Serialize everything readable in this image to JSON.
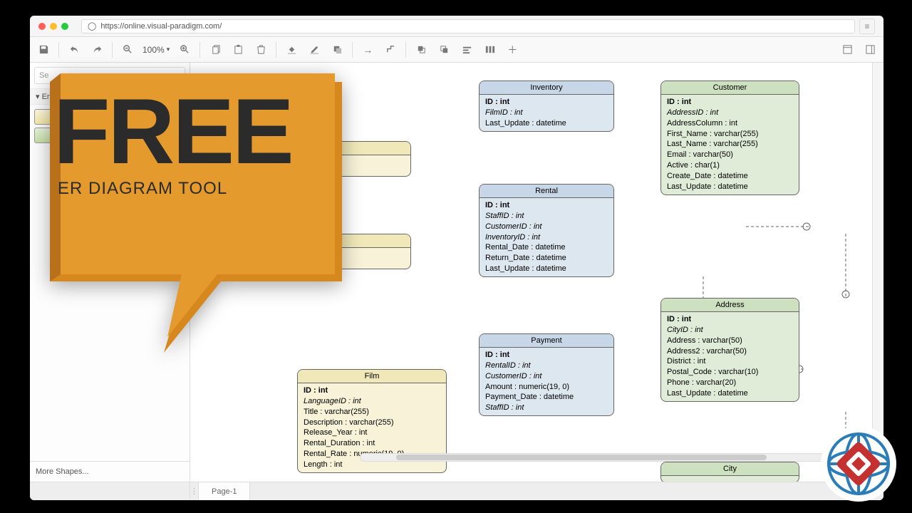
{
  "url": "https://online.visual-paradigm.com/",
  "toolbar": {
    "zoom": "100%"
  },
  "sidebar": {
    "search_placeholder": "Se",
    "panel": "En",
    "more": "More Shapes..."
  },
  "tabs": {
    "page1": "Page-1"
  },
  "promo": {
    "big": "FREE",
    "sub": "ER DIAGRAM TOOL"
  },
  "entities": {
    "film": {
      "title": "Film",
      "rows": [
        {
          "t": "ID : int",
          "c": "pk"
        },
        {
          "t": "LanguageID : int",
          "c": "fk"
        },
        {
          "t": "Title : varchar(255)"
        },
        {
          "t": "Description : varchar(255)"
        },
        {
          "t": "Release_Year : int"
        },
        {
          "t": "Rental_Duration : int"
        },
        {
          "t": "Rental_Rate : numeric(19, 0)"
        },
        {
          "t": "Length : int"
        }
      ]
    },
    "inventory": {
      "title": "Inventory",
      "rows": [
        {
          "t": "ID : int",
          "c": "pk"
        },
        {
          "t": "FilmID : int",
          "c": "fk"
        },
        {
          "t": "Last_Update : datetime"
        }
      ]
    },
    "rental": {
      "title": "Rental",
      "rows": [
        {
          "t": "ID : int",
          "c": "pk"
        },
        {
          "t": "StaffID : int",
          "c": "fk"
        },
        {
          "t": "CustomerID : int",
          "c": "fk"
        },
        {
          "t": "InventoryID : int",
          "c": "fk"
        },
        {
          "t": "Rental_Date : datetime"
        },
        {
          "t": "Return_Date : datetime"
        },
        {
          "t": "Last_Update : datetime"
        }
      ]
    },
    "payment": {
      "title": "Payment",
      "rows": [
        {
          "t": "ID : int",
          "c": "pk"
        },
        {
          "t": "RentalID : int",
          "c": "fk"
        },
        {
          "t": "CustomerID : int",
          "c": "fk"
        },
        {
          "t": "Amount : numeric(19, 0)"
        },
        {
          "t": "Payment_Date : datetime"
        },
        {
          "t": "StaffID : int",
          "c": "fk"
        }
      ]
    },
    "customer": {
      "title": "Customer",
      "rows": [
        {
          "t": "ID : int",
          "c": "pk"
        },
        {
          "t": "AddressID : int",
          "c": "fk"
        },
        {
          "t": "AddressColumn : int"
        },
        {
          "t": "First_Name : varchar(255)"
        },
        {
          "t": "Last_Name : varchar(255)"
        },
        {
          "t": "Email : varchar(50)"
        },
        {
          "t": "Active : char(1)"
        },
        {
          "t": "Create_Date : datetime"
        },
        {
          "t": "Last_Update : datetime"
        }
      ]
    },
    "address": {
      "title": "Address",
      "rows": [
        {
          "t": "ID : int",
          "c": "pk"
        },
        {
          "t": "CityID : int",
          "c": "fk"
        },
        {
          "t": "Address : varchar(50)"
        },
        {
          "t": "Address2 : varchar(50)"
        },
        {
          "t": "District : int"
        },
        {
          "t": "Postal_Code : varchar(10)"
        },
        {
          "t": "Phone : varchar(20)"
        },
        {
          "t": "Last_Update : datetime"
        }
      ]
    },
    "city": {
      "title": "City",
      "rows": []
    }
  }
}
